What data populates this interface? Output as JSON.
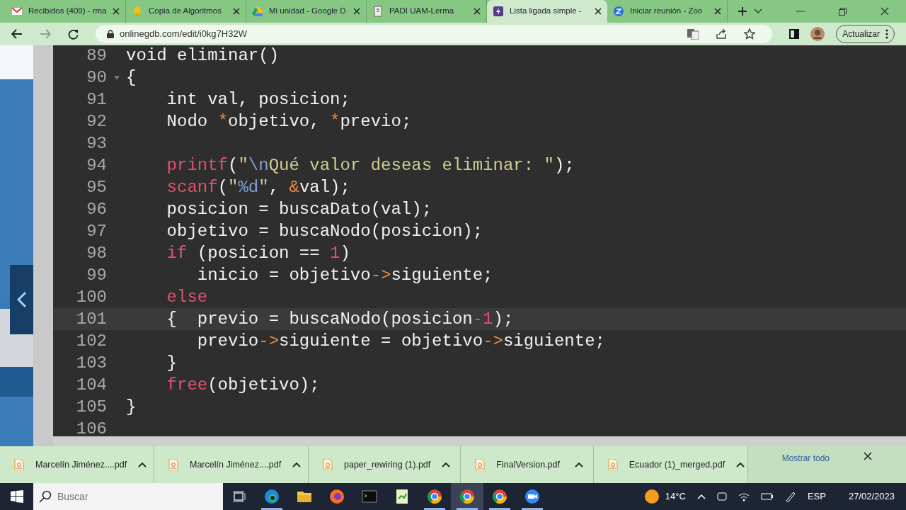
{
  "browser": {
    "tabs": [
      {
        "title": "Recibidos (409) - rma",
        "selected": false
      },
      {
        "title": "Copia de Algoritmos",
        "selected": false
      },
      {
        "title": "Mi unidad - Google D",
        "selected": false
      },
      {
        "title": "PADI UAM-Lerma",
        "selected": false
      },
      {
        "title": "Lista ligada simple -",
        "selected": true
      },
      {
        "title": "Iniciar reunión - Zoo",
        "selected": false
      }
    ],
    "back_enabled": true,
    "forward_enabled": false,
    "url": "onlinegdb.com/edit/i0kg7H32W",
    "update_button": "Actualizar"
  },
  "editor": {
    "lines": [
      {
        "number": "89",
        "active": false,
        "fold": false,
        "tokens": [
          {
            "text": "void eliminar()",
            "kind": "plain"
          }
        ]
      },
      {
        "number": "90",
        "active": false,
        "fold": true,
        "tokens": [
          {
            "text": "{",
            "kind": "plain"
          }
        ]
      },
      {
        "number": "91",
        "active": false,
        "fold": false,
        "tokens": [
          {
            "text": "    int val, posicion;",
            "kind": "plain"
          }
        ]
      },
      {
        "number": "92",
        "active": false,
        "fold": false,
        "tokens": [
          {
            "text": "    Nodo ",
            "kind": "plain"
          },
          {
            "text": "*",
            "kind": "operator"
          },
          {
            "text": "objetivo, ",
            "kind": "plain"
          },
          {
            "text": "*",
            "kind": "operator"
          },
          {
            "text": "previo;",
            "kind": "plain"
          }
        ]
      },
      {
        "number": "93",
        "active": false,
        "fold": false
      },
      {
        "number": "94",
        "active": false,
        "fold": false,
        "tokens": [
          {
            "text": "    printf",
            "kind": "keyword"
          },
          {
            "text": "(",
            "kind": "plain"
          },
          {
            "text": "\"",
            "kind": "string"
          },
          {
            "text": "\\n",
            "kind": "escape"
          },
          {
            "text": "Qué valor deseas eliminar: \"",
            "kind": "string"
          },
          {
            "text": ");",
            "kind": "plain"
          }
        ]
      },
      {
        "number": "95",
        "active": false,
        "fold": false,
        "tokens": [
          {
            "text": "    scanf",
            "kind": "keyword"
          },
          {
            "text": "(",
            "kind": "plain"
          },
          {
            "text": "\"",
            "kind": "string"
          },
          {
            "text": "%d",
            "kind": "escape"
          },
          {
            "text": "\"",
            "kind": "string"
          },
          {
            "text": ", ",
            "kind": "plain"
          },
          {
            "text": "&",
            "kind": "operator"
          },
          {
            "text": "val);",
            "kind": "plain"
          }
        ]
      },
      {
        "number": "96",
        "active": false,
        "fold": false,
        "tokens": [
          {
            "text": "    posicion = buscaDato(val);",
            "kind": "plain"
          }
        ]
      },
      {
        "number": "97",
        "active": false,
        "fold": false,
        "tokens": [
          {
            "text": "    objetivo = buscaNodo(posicion);",
            "kind": "plain"
          }
        ]
      },
      {
        "number": "98",
        "active": false,
        "fold": false,
        "tokens": [
          {
            "text": "    if",
            "kind": "keyword"
          },
          {
            "text": " (posicion == ",
            "kind": "plain"
          },
          {
            "text": "1",
            "kind": "number"
          },
          {
            "text": ")",
            "kind": "plain"
          }
        ]
      },
      {
        "number": "99",
        "active": false,
        "fold": false,
        "tokens": [
          {
            "text": "       inicio = objetivo",
            "kind": "plain"
          },
          {
            "text": "->",
            "kind": "operator"
          },
          {
            "text": "siguiente;",
            "kind": "plain"
          }
        ]
      },
      {
        "number": "100",
        "active": false,
        "fold": false,
        "tokens": [
          {
            "text": "    else",
            "kind": "keyword"
          }
        ]
      },
      {
        "number": "101",
        "active": true,
        "fold": false,
        "tokens": [
          {
            "text": "    {  previo = buscaNodo(posicion",
            "kind": "plain"
          },
          {
            "text": "-1",
            "kind": "number"
          },
          {
            "text": ");",
            "kind": "plain"
          }
        ]
      },
      {
        "number": "102",
        "active": false,
        "fold": false,
        "tokens": [
          {
            "text": "       previo",
            "kind": "plain"
          },
          {
            "text": "->",
            "kind": "operator"
          },
          {
            "text": "siguiente = objetivo",
            "kind": "plain"
          },
          {
            "text": "->",
            "kind": "operator"
          },
          {
            "text": "siguiente;",
            "kind": "plain"
          }
        ]
      },
      {
        "number": "103",
        "active": false,
        "fold": false,
        "tokens": [
          {
            "text": "    }",
            "kind": "plain"
          }
        ]
      },
      {
        "number": "104",
        "active": false,
        "fold": false,
        "tokens": [
          {
            "text": "    free",
            "kind": "keyword"
          },
          {
            "text": "(objetivo);",
            "kind": "plain"
          }
        ]
      },
      {
        "number": "105",
        "active": false,
        "fold": false,
        "tokens": [
          {
            "text": "}",
            "kind": "plain"
          }
        ]
      },
      {
        "number": "106",
        "active": false,
        "fold": false
      }
    ]
  },
  "downloads": {
    "items": [
      {
        "name": "Marcelín Jiménez....pdf"
      },
      {
        "name": "Marcelín Jiménez....pdf"
      },
      {
        "name": "paper_rewiring (1).pdf"
      },
      {
        "name": "FinalVersion.pdf"
      },
      {
        "name": "Ecuador (1)_merged.pdf"
      }
    ],
    "show_all": "Mostrar todo"
  },
  "taskbar": {
    "search_placeholder": "Buscar",
    "apps": [
      {
        "running": true,
        "active": false
      },
      {
        "running": false,
        "active": false
      },
      {
        "running": false,
        "active": false
      },
      {
        "running": false,
        "active": false
      },
      {
        "running": false,
        "active": false
      },
      {
        "running": true,
        "active": false
      },
      {
        "running": true,
        "active": true
      },
      {
        "running": true,
        "active": false
      },
      {
        "running": true,
        "active": false
      }
    ],
    "weather": "14°C",
    "language": "ESP",
    "date": "27/02/2023"
  }
}
